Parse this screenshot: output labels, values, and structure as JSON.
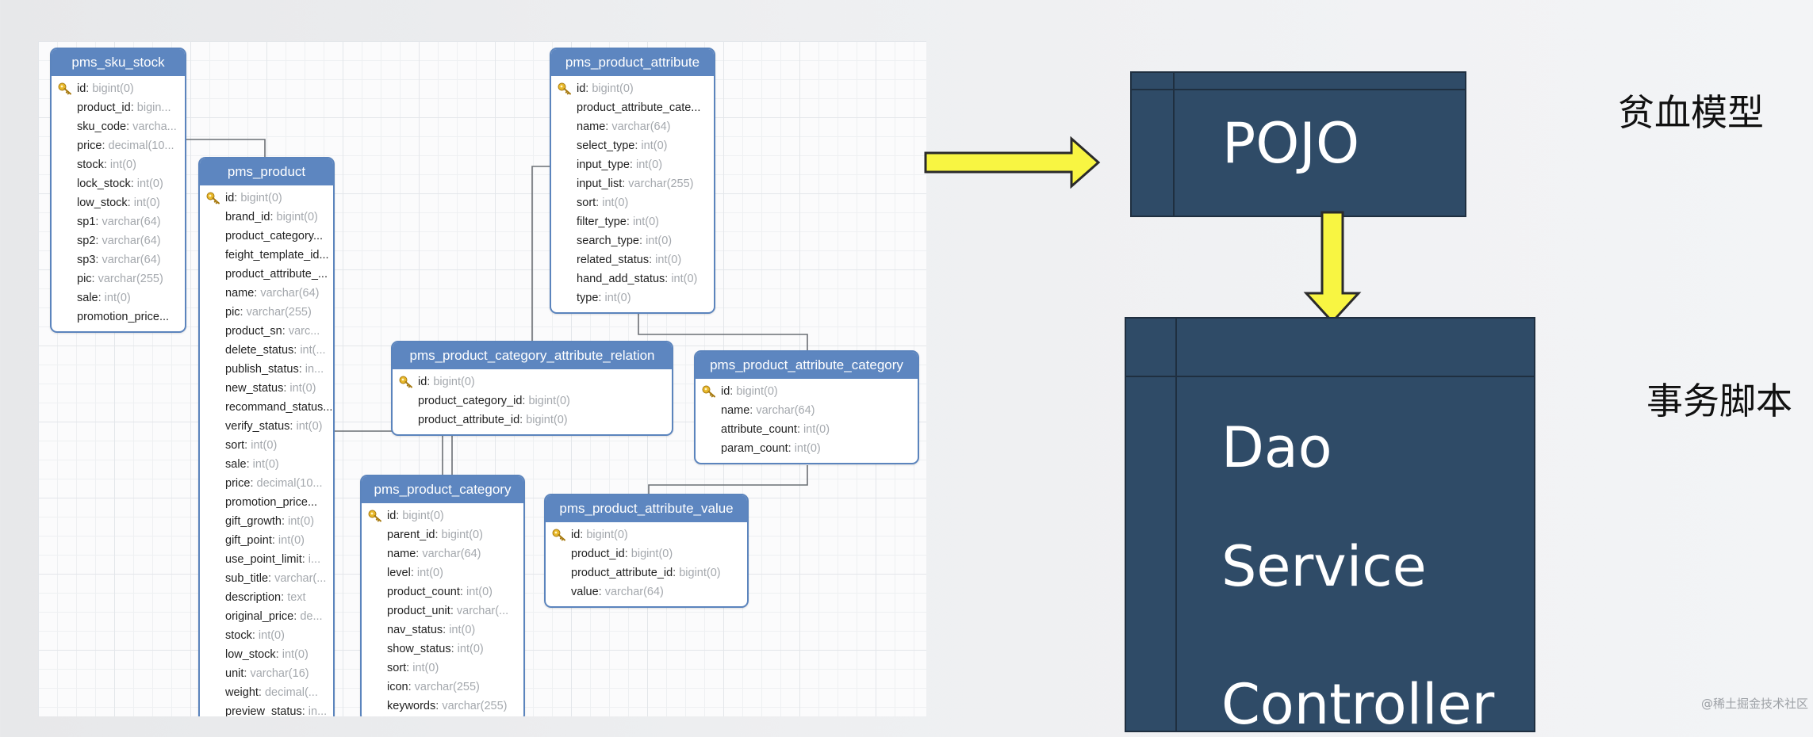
{
  "er_tables": [
    {
      "id": "sku",
      "name": "pms_sku_stock",
      "columns": [
        {
          "name": "id",
          "type": "bigint(0)",
          "key": true
        },
        {
          "name": "product_id",
          "type": "bigin..."
        },
        {
          "name": "sku_code",
          "type": "varcha..."
        },
        {
          "name": "price",
          "type": "decimal(10..."
        },
        {
          "name": "stock",
          "type": "int(0)"
        },
        {
          "name": "lock_stock",
          "type": "int(0)"
        },
        {
          "name": "low_stock",
          "type": "int(0)"
        },
        {
          "name": "sp1",
          "type": "varchar(64)"
        },
        {
          "name": "sp2",
          "type": "varchar(64)"
        },
        {
          "name": "sp3",
          "type": "varchar(64)"
        },
        {
          "name": "pic",
          "type": "varchar(255)"
        },
        {
          "name": "sale",
          "type": "int(0)"
        },
        {
          "name": "promotion_price...",
          "type": ""
        }
      ]
    },
    {
      "id": "product",
      "name": "pms_product",
      "columns": [
        {
          "name": "id",
          "type": "bigint(0)",
          "key": true
        },
        {
          "name": "brand_id",
          "type": "bigint(0)"
        },
        {
          "name": "product_category...",
          "type": ""
        },
        {
          "name": "feight_template_id...",
          "type": ""
        },
        {
          "name": "product_attribute_...",
          "type": ""
        },
        {
          "name": "name",
          "type": "varchar(64)"
        },
        {
          "name": "pic",
          "type": "varchar(255)"
        },
        {
          "name": "product_sn",
          "type": "varc..."
        },
        {
          "name": "delete_status",
          "type": "int(..."
        },
        {
          "name": "publish_status",
          "type": "in..."
        },
        {
          "name": "new_status",
          "type": "int(0)"
        },
        {
          "name": "recommand_status...",
          "type": ""
        },
        {
          "name": "verify_status",
          "type": "int(0)"
        },
        {
          "name": "sort",
          "type": "int(0)"
        },
        {
          "name": "sale",
          "type": "int(0)"
        },
        {
          "name": "price",
          "type": "decimal(10..."
        },
        {
          "name": "promotion_price...",
          "type": ""
        },
        {
          "name": "gift_growth",
          "type": "int(0)"
        },
        {
          "name": "gift_point",
          "type": "int(0)"
        },
        {
          "name": "use_point_limit",
          "type": "i..."
        },
        {
          "name": "sub_title",
          "type": "varchar(..."
        },
        {
          "name": "description",
          "type": "text"
        },
        {
          "name": "original_price",
          "type": "de..."
        },
        {
          "name": "stock",
          "type": "int(0)"
        },
        {
          "name": "low_stock",
          "type": "int(0)"
        },
        {
          "name": "unit",
          "type": "varchar(16)"
        },
        {
          "name": "weight",
          "type": "decimal(..."
        },
        {
          "name": "preview_status",
          "type": "in..."
        }
      ]
    },
    {
      "id": "attr",
      "name": "pms_product_attribute",
      "columns": [
        {
          "name": "id",
          "type": "bigint(0)",
          "key": true
        },
        {
          "name": "product_attribute_cate...",
          "type": ""
        },
        {
          "name": "name",
          "type": "varchar(64)"
        },
        {
          "name": "select_type",
          "type": "int(0)"
        },
        {
          "name": "input_type",
          "type": "int(0)"
        },
        {
          "name": "input_list",
          "type": "varchar(255)"
        },
        {
          "name": "sort",
          "type": "int(0)"
        },
        {
          "name": "filter_type",
          "type": "int(0)"
        },
        {
          "name": "search_type",
          "type": "int(0)"
        },
        {
          "name": "related_status",
          "type": "int(0)"
        },
        {
          "name": "hand_add_status",
          "type": "int(0)"
        },
        {
          "name": "type",
          "type": "int(0)"
        }
      ]
    },
    {
      "id": "relation",
      "name": "pms_product_category_attribute_relation",
      "columns": [
        {
          "name": "id",
          "type": "bigint(0)",
          "key": true
        },
        {
          "name": "product_category_id",
          "type": "bigint(0)"
        },
        {
          "name": "product_attribute_id",
          "type": "bigint(0)"
        }
      ]
    },
    {
      "id": "attrcat",
      "name": "pms_product_attribute_category",
      "columns": [
        {
          "name": "id",
          "type": "bigint(0)",
          "key": true
        },
        {
          "name": "name",
          "type": "varchar(64)"
        },
        {
          "name": "attribute_count",
          "type": "int(0)"
        },
        {
          "name": "param_count",
          "type": "int(0)"
        }
      ]
    },
    {
      "id": "category",
      "name": "pms_product_category",
      "columns": [
        {
          "name": "id",
          "type": "bigint(0)",
          "key": true
        },
        {
          "name": "parent_id",
          "type": "bigint(0)"
        },
        {
          "name": "name",
          "type": "varchar(64)"
        },
        {
          "name": "level",
          "type": "int(0)"
        },
        {
          "name": "product_count",
          "type": "int(0)"
        },
        {
          "name": "product_unit",
          "type": "varchar(..."
        },
        {
          "name": "nav_status",
          "type": "int(0)"
        },
        {
          "name": "show_status",
          "type": "int(0)"
        },
        {
          "name": "sort",
          "type": "int(0)"
        },
        {
          "name": "icon",
          "type": "varchar(255)"
        },
        {
          "name": "keywords",
          "type": "varchar(255)"
        }
      ]
    },
    {
      "id": "attrval",
      "name": "pms_product_attribute_value",
      "columns": [
        {
          "name": "id",
          "type": "bigint(0)",
          "key": true
        },
        {
          "name": "product_id",
          "type": "bigint(0)"
        },
        {
          "name": "product_attribute_id",
          "type": "bigint(0)"
        },
        {
          "name": "value",
          "type": "varchar(64)"
        }
      ]
    }
  ],
  "layers": {
    "pojo": "POJO",
    "dao": "Dao",
    "service": "Service",
    "controller": "Controller"
  },
  "labels": {
    "anemic_model": "贫血模型",
    "transaction_script": "事务脚本"
  },
  "watermark": "@稀土掘金技术社区",
  "colors": {
    "table_header": "#5d86c0",
    "layer_box": "#2f4b67",
    "arrow_fill": "#f8f542"
  }
}
